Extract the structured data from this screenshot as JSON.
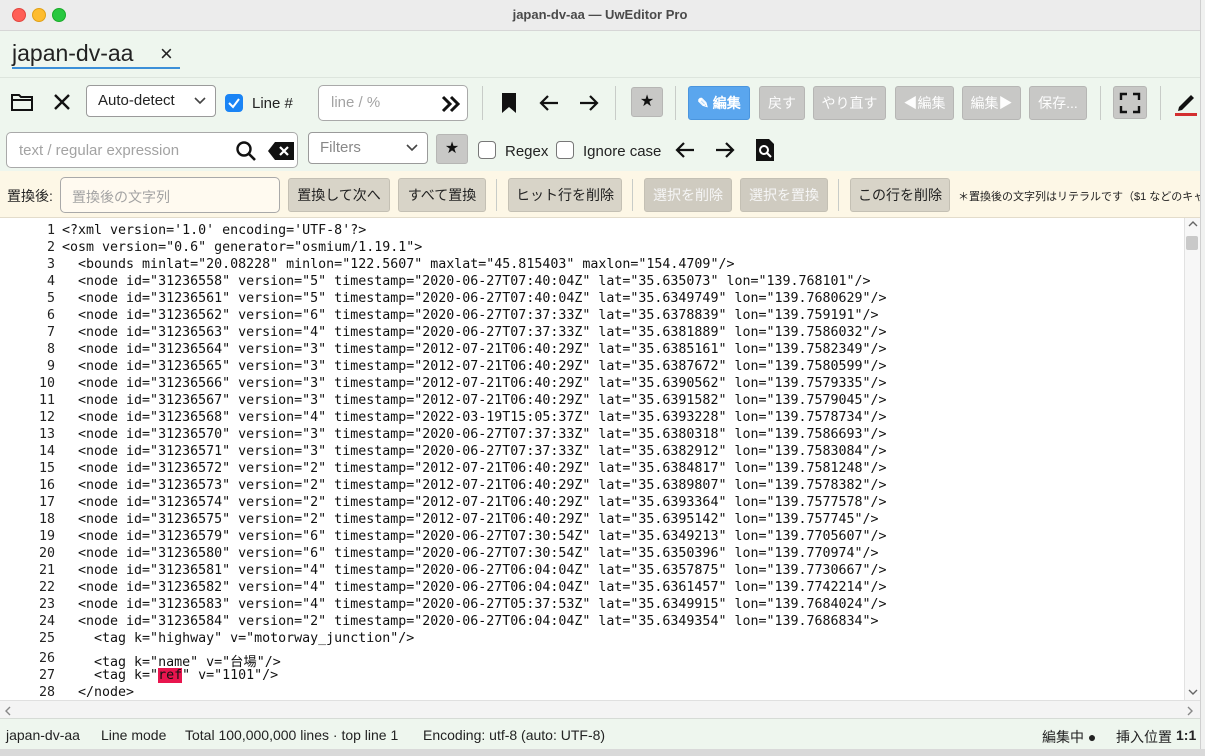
{
  "window": {
    "title": "japan-dv-aa — UwEditor Pro"
  },
  "tab": {
    "label": "japan-dv-aa",
    "close": "×"
  },
  "toolbar": {
    "encoding_select": "Auto-detect",
    "line_mode_label": "Line #",
    "line_mode_checked": true,
    "goto_placeholder": "line / %",
    "star": "★",
    "edit_button": "✎ 編集",
    "undo_button": "戻す",
    "redo_button": "やり直す",
    "prev_edit_button": "◀編集",
    "next_edit_button": "編集▶",
    "save_button": "保存..."
  },
  "search": {
    "placeholder": "text / regular expression",
    "filters_select": "Filters",
    "star": "★",
    "regex_label": "Regex",
    "ignore_case_label": "Ignore case"
  },
  "replace": {
    "label": "置換後:",
    "placeholder": "置換後の文字列",
    "replace_next": "置換して次へ",
    "replace_all": "すべて置換",
    "delete_hit_lines": "ヒット行を削除",
    "delete_selection": "選択を削除",
    "replace_selection": "選択を置換",
    "delete_this_line": "この行を削除",
    "note": "＊置換後の文字列はリテラルです（$1 などのキャ"
  },
  "editor": {
    "lines": [
      {
        "n": "1",
        "text": "<?xml version='1.0' encoding='UTF-8'?>"
      },
      {
        "n": "2",
        "text": "<osm version=\"0.6\" generator=\"osmium/1.19.1\">"
      },
      {
        "n": "3",
        "text": "  <bounds minlat=\"20.08228\" minlon=\"122.5607\" maxlat=\"45.815403\" maxlon=\"154.4709\"/>"
      },
      {
        "n": "4",
        "text": "  <node id=\"31236558\" version=\"5\" timestamp=\"2020-06-27T07:40:04Z\" lat=\"35.635073\" lon=\"139.768101\"/>"
      },
      {
        "n": "5",
        "text": "  <node id=\"31236561\" version=\"5\" timestamp=\"2020-06-27T07:40:04Z\" lat=\"35.6349749\" lon=\"139.7680629\"/>"
      },
      {
        "n": "6",
        "text": "  <node id=\"31236562\" version=\"6\" timestamp=\"2020-06-27T07:37:33Z\" lat=\"35.6378839\" lon=\"139.759191\"/>"
      },
      {
        "n": "7",
        "text": "  <node id=\"31236563\" version=\"4\" timestamp=\"2020-06-27T07:37:33Z\" lat=\"35.6381889\" lon=\"139.7586032\"/>"
      },
      {
        "n": "8",
        "text": "  <node id=\"31236564\" version=\"3\" timestamp=\"2012-07-21T06:40:29Z\" lat=\"35.6385161\" lon=\"139.7582349\"/>"
      },
      {
        "n": "9",
        "text": "  <node id=\"31236565\" version=\"3\" timestamp=\"2012-07-21T06:40:29Z\" lat=\"35.6387672\" lon=\"139.7580599\"/>"
      },
      {
        "n": "10",
        "text": "  <node id=\"31236566\" version=\"3\" timestamp=\"2012-07-21T06:40:29Z\" lat=\"35.6390562\" lon=\"139.7579335\"/>"
      },
      {
        "n": "11",
        "text": "  <node id=\"31236567\" version=\"3\" timestamp=\"2012-07-21T06:40:29Z\" lat=\"35.6391582\" lon=\"139.7579045\"/>"
      },
      {
        "n": "12",
        "text": "  <node id=\"31236568\" version=\"4\" timestamp=\"2022-03-19T15:05:37Z\" lat=\"35.6393228\" lon=\"139.7578734\"/>"
      },
      {
        "n": "13",
        "text": "  <node id=\"31236570\" version=\"3\" timestamp=\"2020-06-27T07:37:33Z\" lat=\"35.6380318\" lon=\"139.7586693\"/>"
      },
      {
        "n": "14",
        "text": "  <node id=\"31236571\" version=\"3\" timestamp=\"2020-06-27T07:37:33Z\" lat=\"35.6382912\" lon=\"139.7583084\"/>"
      },
      {
        "n": "15",
        "text": "  <node id=\"31236572\" version=\"2\" timestamp=\"2012-07-21T06:40:29Z\" lat=\"35.6384817\" lon=\"139.7581248\"/>"
      },
      {
        "n": "16",
        "text": "  <node id=\"31236573\" version=\"2\" timestamp=\"2012-07-21T06:40:29Z\" lat=\"35.6389807\" lon=\"139.7578382\"/>"
      },
      {
        "n": "17",
        "text": "  <node id=\"31236574\" version=\"2\" timestamp=\"2012-07-21T06:40:29Z\" lat=\"35.6393364\" lon=\"139.7577578\"/>"
      },
      {
        "n": "18",
        "text": "  <node id=\"31236575\" version=\"2\" timestamp=\"2012-07-21T06:40:29Z\" lat=\"35.6395142\" lon=\"139.757745\"/>"
      },
      {
        "n": "19",
        "text": "  <node id=\"31236579\" version=\"6\" timestamp=\"2020-06-27T07:30:54Z\" lat=\"35.6349213\" lon=\"139.7705607\"/>"
      },
      {
        "n": "20",
        "text": "  <node id=\"31236580\" version=\"6\" timestamp=\"2020-06-27T07:30:54Z\" lat=\"35.6350396\" lon=\"139.770974\"/>"
      },
      {
        "n": "21",
        "text": "  <node id=\"31236581\" version=\"4\" timestamp=\"2020-06-27T06:04:04Z\" lat=\"35.6357875\" lon=\"139.7730667\"/>"
      },
      {
        "n": "22",
        "text": "  <node id=\"31236582\" version=\"4\" timestamp=\"2020-06-27T06:04:04Z\" lat=\"35.6361457\" lon=\"139.7742214\"/>"
      },
      {
        "n": "23",
        "text": "  <node id=\"31236583\" version=\"4\" timestamp=\"2020-06-27T05:37:53Z\" lat=\"35.6349915\" lon=\"139.7684024\"/>"
      },
      {
        "n": "24",
        "text": "  <node id=\"31236584\" version=\"2\" timestamp=\"2020-06-27T06:04:04Z\" lat=\"35.6349354\" lon=\"139.7686834\">"
      },
      {
        "n": "25",
        "text": "    <tag k=\"highway\" v=\"motorway_junction\"/>"
      },
      {
        "n": "26",
        "text": "    <tag k=\"name\" v=\"台場\"/>"
      },
      {
        "n": "27",
        "pre": "    <tag k=\"",
        "hl": "ref",
        "post": "\" v=\"1101\"/>"
      },
      {
        "n": "28",
        "text": "  </node>"
      }
    ]
  },
  "status": {
    "file": "japan-dv-aa",
    "mode": "Line mode",
    "total": "Total 100,000,000 lines · top line 1",
    "encoding": "Encoding: utf-8 (auto: UTF-8)",
    "editing": "編集中 ●",
    "insert_label": "挿入位置",
    "position": "1:1"
  },
  "colors": {
    "accent": "#1a84f5",
    "edit_button": "#5aa6ee",
    "highlight": "#e8154e",
    "replace_bar": "#fdf7e6"
  }
}
